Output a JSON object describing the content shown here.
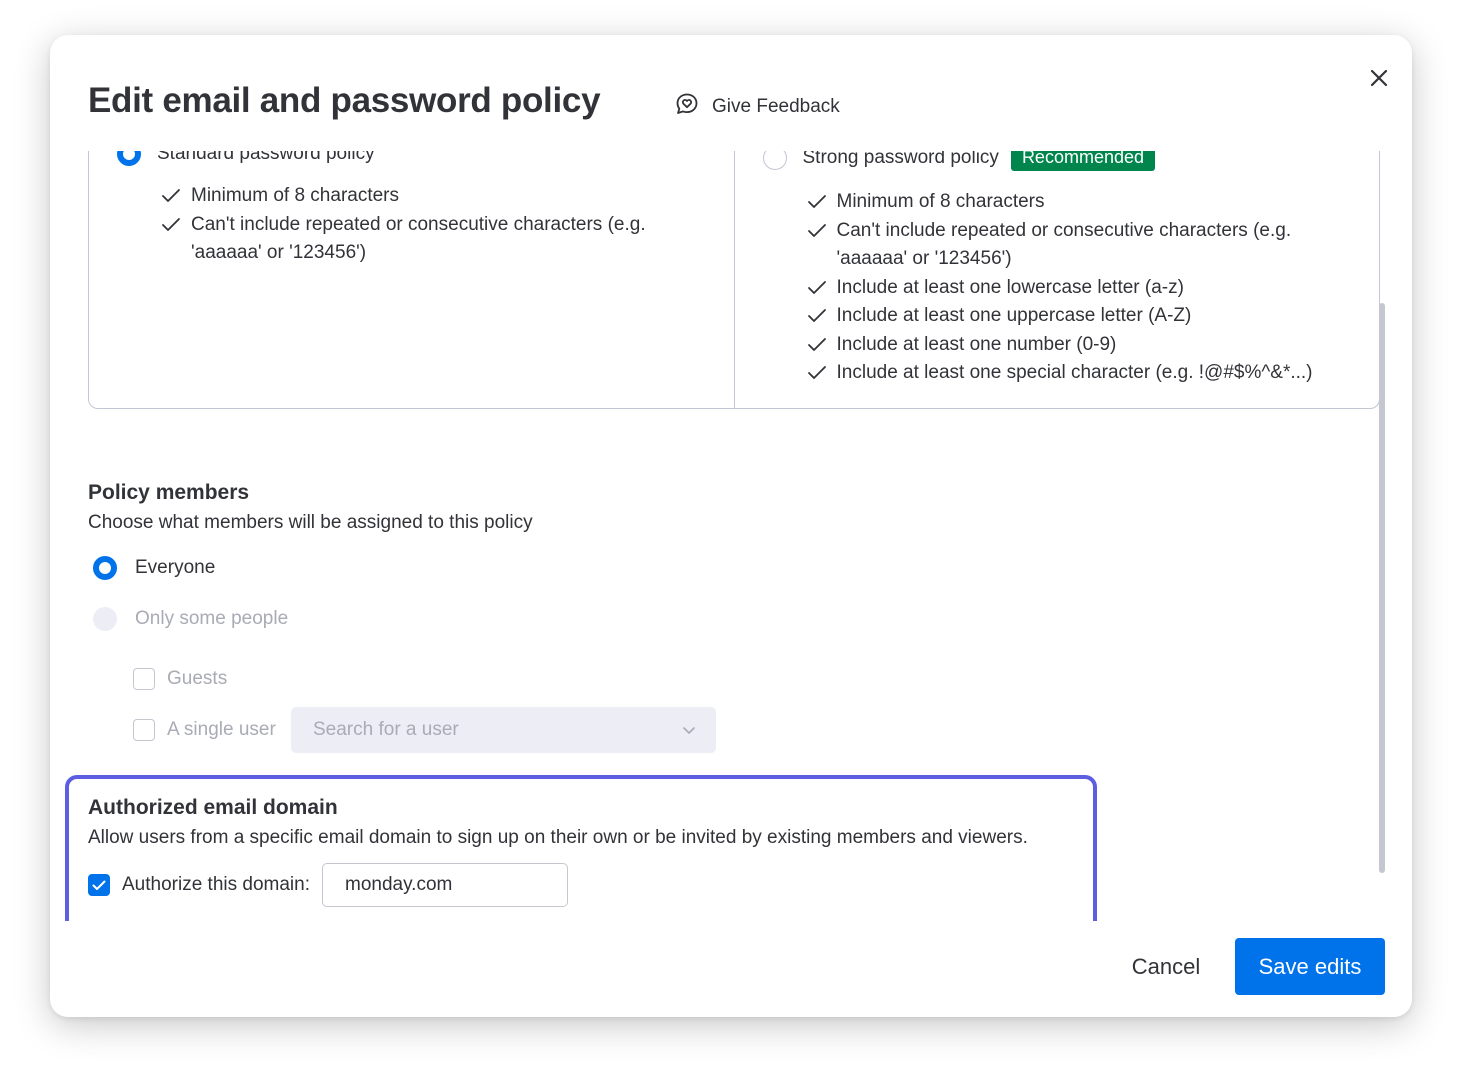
{
  "modal": {
    "title": "Edit email and password policy",
    "feedback_label": "Give Feedback"
  },
  "policies": {
    "standard": {
      "label": "Standard password policy",
      "selected": true,
      "requirements": [
        "Minimum of 8 characters",
        "Can't include repeated or consecutive characters (e.g. 'aaaaaa' or '123456')"
      ]
    },
    "strong": {
      "label": "Strong password policy",
      "badge": "Recommended",
      "selected": false,
      "requirements": [
        "Minimum of 8 characters",
        "Can't include repeated or consecutive characters (e.g. 'aaaaaa' or '123456')",
        "Include at least one lowercase letter (a-z)",
        "Include at least one uppercase letter (A-Z)",
        "Include at least one number (0-9)",
        "Include at least one special character (e.g. !@#$%^&*...)"
      ]
    }
  },
  "policy_members": {
    "title": "Policy members",
    "description": "Choose what members will be assigned to this policy",
    "options": [
      {
        "label": "Everyone",
        "selected": true,
        "disabled": false
      },
      {
        "label": "Only some people",
        "selected": false,
        "disabled": true
      }
    ],
    "sub_options": {
      "guests_label": "Guests",
      "single_user_label": "A single user",
      "search_placeholder": "Search for a user"
    }
  },
  "authorized_domain": {
    "title": "Authorized email domain",
    "description": "Allow users from a specific email domain to sign up on their own or be invited by existing members and viewers.",
    "checkbox_label": "Authorize this domain:",
    "checked": true,
    "domain_value": "monday.com"
  },
  "footer": {
    "cancel_label": "Cancel",
    "save_label": "Save edits"
  },
  "colors": {
    "primary": "#0073ea",
    "badge_green": "#00854d",
    "highlight": "#5d5fe0",
    "text": "#323338",
    "disabled_text": "#a9abb5"
  },
  "icons": {
    "feedback": "chat-heart-icon",
    "close": "close-icon",
    "check": "check-icon",
    "dropdown": "chevron-down-icon"
  }
}
